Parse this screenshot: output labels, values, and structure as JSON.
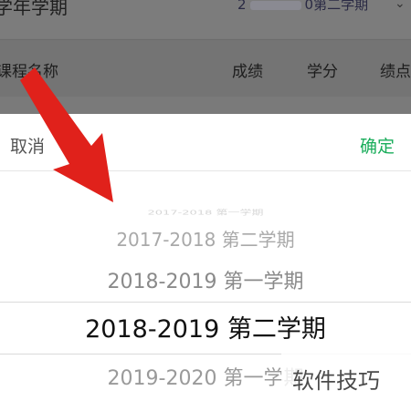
{
  "page": {
    "title": "学年学期",
    "term_selector_prefix": "2",
    "term_selector_suffix": "0第二学期",
    "columns": [
      "课程名称",
      "成绩",
      "学分",
      "绩点"
    ]
  },
  "picker": {
    "cancel_label": "取消",
    "confirm_label": "确定",
    "options": [
      "2017-2018 第一学期",
      "2017-2018 第二学期",
      "2018-2019 第一学期",
      "2018-2019 第二学期",
      "2019-2020 第一学期"
    ],
    "selected_index": 3
  },
  "watermark": "软件技巧",
  "colors": {
    "confirm": "#1aad5b",
    "arrow": "#e0211b",
    "overlay": "#6f6f6f"
  }
}
